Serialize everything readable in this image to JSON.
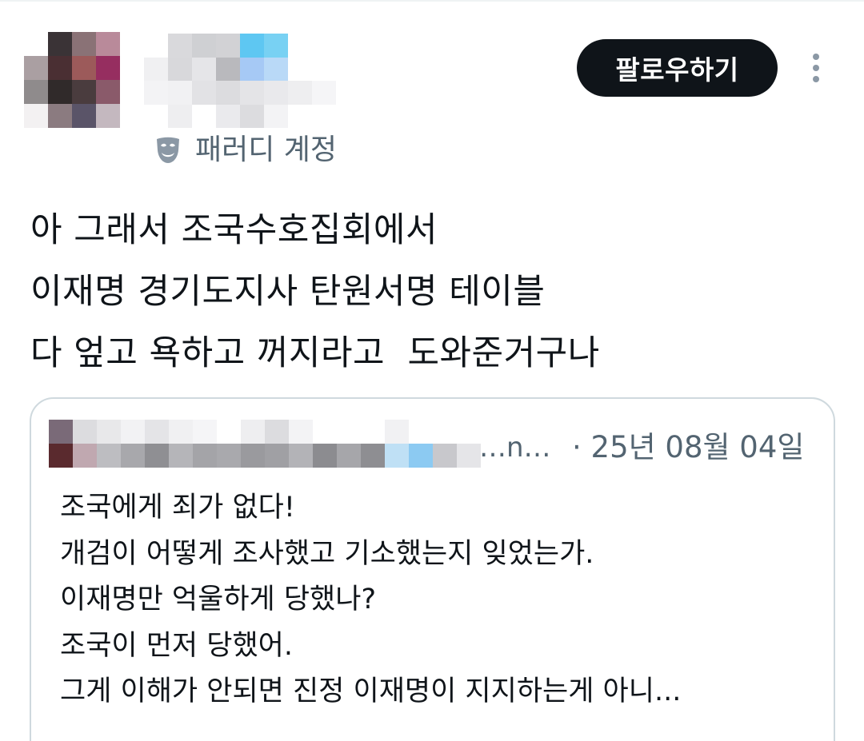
{
  "header": {
    "parody_label": "패러디 계정",
    "follow_label": "팔로우하기",
    "avatar_pixels": [
      "#ffffff",
      "#3a3336",
      "#8a7276",
      "#b98a9a",
      "#aa9fa2",
      "#4a2f33",
      "#9c5a5a",
      "#962e60",
      "#8f8b8c",
      "#302a2a",
      "#4a3c3e",
      "#8a5a6a",
      "#f3f1f2",
      "#8b7b80",
      "#5a5468",
      "#c4b8bf"
    ],
    "name_pixels": [
      "#ffffff",
      "#d9d9dc",
      "#cfd0d3",
      "#d2d2d5",
      "#5ec7f2",
      "#78d1f3",
      "#ffffff",
      "#ffffff",
      "#f0f0f2",
      "#d8d8db",
      "#e5e5e8",
      "#b9b9bd",
      "#a6c9f5",
      "#b9d9f7",
      "#ffffff",
      "#ffffff",
      "#f3f3f5",
      "#f1f1f3",
      "#e2e2e5",
      "#dcdcdf",
      "#e4e4e7",
      "#e9e9ec",
      "#eeeef0",
      "#f5f5f7",
      "#ffffff",
      "#eeeef0",
      "#ffffff",
      "#eaeaed",
      "#dcdcdf",
      "#f3f3f5",
      "#ffffff",
      "#ffffff"
    ]
  },
  "tweet": {
    "lines": [
      "아 그래서 조국수호집회에서",
      "이재명 경기도지사 탄원서명 테이블",
      "다 엎고 욕하고 꺼지라고  도와준거구나"
    ]
  },
  "quote": {
    "handle_fragment": "…n…",
    "date": "· 25년 08월 04일",
    "lines": [
      "조국에게 죄가 없다!",
      "개검이 어떻게 조사했고 기소했는지 잊었는가.",
      "이재명만 억울하게 당했나?",
      "조국이 먼저 당했어.",
      "그게 이해가 안되면 진정 이재명이 지지하는게 아니..."
    ],
    "avatar_pixels": [
      "#7a6a78",
      "#dcdcdf",
      "#5a2a2e",
      "#c0a8b0"
    ],
    "name_pixels": [
      "#e8e8ea",
      "#f2f2f4",
      "#e4e4e7",
      "#f0f0f2",
      "#f5f5f7",
      "#ffffff",
      "#eeeef0",
      "#dcdcdf",
      "#f3f3f5",
      "#ffffff",
      "#ffffff",
      "#ffffff",
      "#f1f1f3",
      "#ffffff",
      "#ffffff",
      "#ffffff",
      "#bdbdc1",
      "#a8a8ac",
      "#8f8f93",
      "#b5b5b9",
      "#a4a4a8",
      "#a9a9ad",
      "#9a9a9e",
      "#a0a0a4",
      "#b3b3b7",
      "#8c8c90",
      "#a6a6aa",
      "#8e8e92",
      "#bfe0f5",
      "#8ccaf2",
      "#c8c8cc",
      "#e5e5e8"
    ]
  },
  "colors": {
    "text": "#0f1419",
    "secondary": "#536471",
    "border": "#cfd9de",
    "follow_bg": "#0f1419",
    "follow_text": "#ffffff",
    "more_dots": "#8b98a5"
  },
  "icons": {
    "parody": "theater-mask-icon",
    "more": "more-vertical-icon"
  }
}
